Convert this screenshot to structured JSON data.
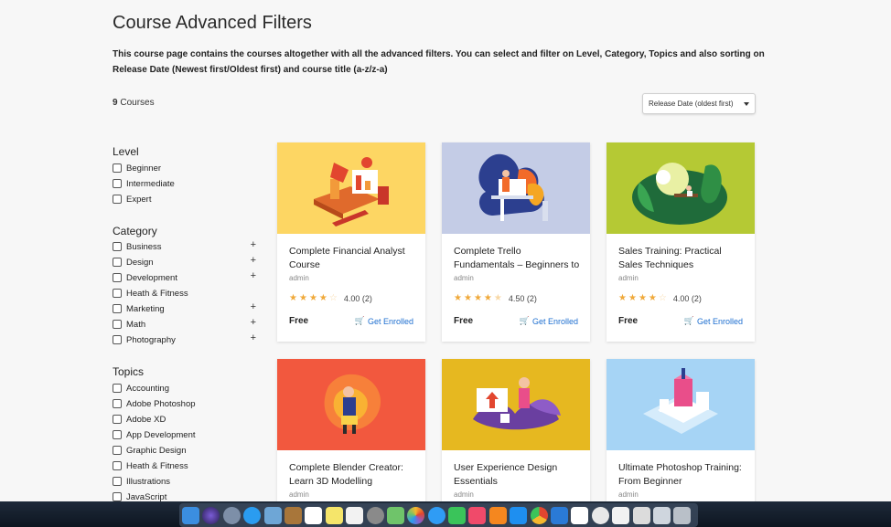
{
  "page": {
    "title": "Course Advanced Filters",
    "description": "This course page contains the courses altogether with all the advanced filters. You can select and filter on Level, Category, Topics and also sorting on Release Date (Newest first/Oldest first) and course title (a-z/z-a)",
    "count_number": "9",
    "count_label": "Courses",
    "sort_value": "Release Date (oldest first)"
  },
  "filters": {
    "level": {
      "heading": "Level",
      "items": [
        "Beginner",
        "Intermediate",
        "Expert"
      ]
    },
    "category": {
      "heading": "Category",
      "items": [
        "Business",
        "Design",
        "Development",
        "Heath & Fitness",
        "Marketing",
        "Math",
        "Photography"
      ],
      "expand_symbol": "+"
    },
    "topics": {
      "heading": "Topics",
      "items": [
        "Accounting",
        "Adobe Photoshop",
        "Adobe XD",
        "App Development",
        "Graphic Design",
        "Heath & Fitness",
        "Illustrations",
        "JavaScript"
      ]
    }
  },
  "cards": [
    {
      "title": "Complete Financial Analyst Course",
      "author": "admin",
      "rating": 4.0,
      "rating_text": "4.00",
      "reviews": "(2)",
      "price": "Free",
      "cta": "Get Enrolled",
      "thumb_color": "#fdd663"
    },
    {
      "title": "Complete Trello Fundamentals – Beginners to",
      "author": "admin",
      "rating": 4.5,
      "rating_text": "4.50",
      "reviews": "(2)",
      "price": "Free",
      "cta": "Get Enrolled",
      "thumb_color": "#c4cce6"
    },
    {
      "title": "Sales Training: Practical Sales Techniques",
      "author": "admin",
      "rating": 4.0,
      "rating_text": "4.00",
      "reviews": "(2)",
      "price": "Free",
      "cta": "Get Enrolled",
      "thumb_color": "#b5c934"
    },
    {
      "title": "Complete Blender Creator: Learn 3D Modelling",
      "author": "admin",
      "thumb_color": "#f2583e"
    },
    {
      "title": "User Experience Design Essentials",
      "author": "admin",
      "thumb_color": "#e6b820"
    },
    {
      "title": "Ultimate Photoshop Training: From Beginner",
      "author": "admin",
      "thumb_color": "#a6d4f5"
    }
  ],
  "icons": {
    "star": "star-icon",
    "cart": "cart-icon",
    "plus": "plus-icon"
  },
  "colors": {
    "accent": "#1e6fd0",
    "star": "#f0a93a",
    "background": "#f7f7f7"
  },
  "dock_icons": [
    "finder-icon",
    "siri-icon",
    "launchpad-icon",
    "safari-icon",
    "preview-icon",
    "notes-icon",
    "calendar-icon",
    "stickies-icon",
    "reminders-icon",
    "settings-icon",
    "maps-icon",
    "photos-icon",
    "messages-icon",
    "facetime-icon",
    "music-icon",
    "books-icon",
    "appstore-icon",
    "chrome-icon",
    "vscode-icon",
    "slack-icon",
    "evernote-icon",
    "document-icon",
    "screenshot-icon",
    "folder-icon",
    "trash-icon"
  ]
}
